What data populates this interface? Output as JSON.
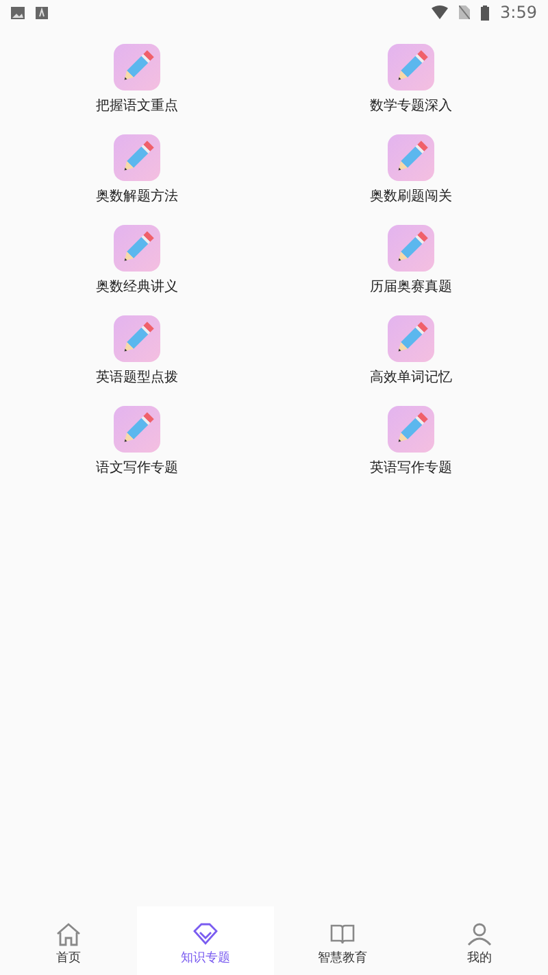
{
  "status_bar": {
    "time": "3:59"
  },
  "topics": [
    {
      "label": "把握语文重点"
    },
    {
      "label": "数学专题深入"
    },
    {
      "label": "奥数解题方法"
    },
    {
      "label": "奥数刷题闯关"
    },
    {
      "label": "奥数经典讲义"
    },
    {
      "label": "历届奥赛真题"
    },
    {
      "label": "英语题型点拨"
    },
    {
      "label": "高效单词记忆"
    },
    {
      "label": "语文写作专题"
    },
    {
      "label": "英语写作专题"
    }
  ],
  "tabs": [
    {
      "label": "首页",
      "selected": false,
      "kind": "home"
    },
    {
      "label": "知识专题",
      "selected": true,
      "kind": "topic"
    },
    {
      "label": "智慧教育",
      "selected": false,
      "kind": "edu"
    },
    {
      "label": "我的",
      "selected": false,
      "kind": "me"
    }
  ]
}
